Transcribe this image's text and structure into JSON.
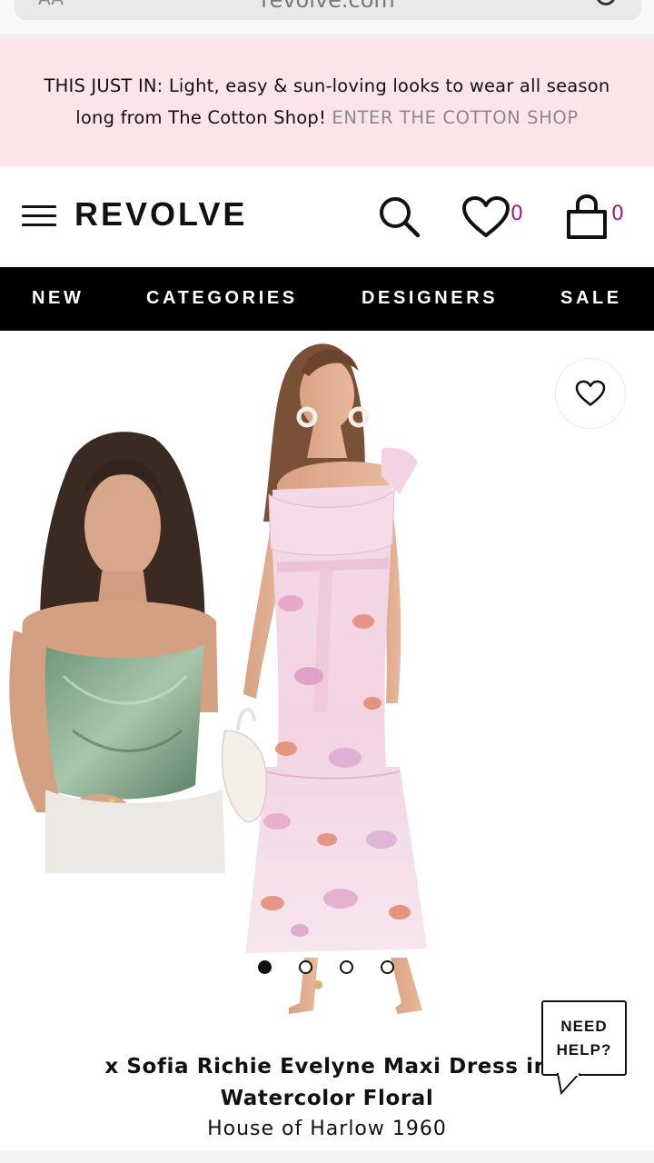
{
  "browser": {
    "url": "revolve.com",
    "reader_label": "AA"
  },
  "promo": {
    "text": "THIS JUST IN: Light, easy & sun-loving looks to wear all season long from The Cotton Shop!",
    "link": "ENTER THE COTTON SHOP"
  },
  "header": {
    "logo": "REVOLVE",
    "wishlist_count": "0",
    "cart_count": "0",
    "accent_color": "#9b1d82"
  },
  "nav": {
    "items": [
      "NEW",
      "CATEGORIES",
      "DESIGNERS",
      "SALE"
    ]
  },
  "gallery": {
    "slides": 4,
    "active_slide": 1
  },
  "product": {
    "title": "x Sofia Richie Evelyne Maxi Dress in Watercolor Floral",
    "brand": "House of Harlow 1960"
  },
  "help": {
    "line1": "NEED",
    "line2": "HELP?"
  }
}
